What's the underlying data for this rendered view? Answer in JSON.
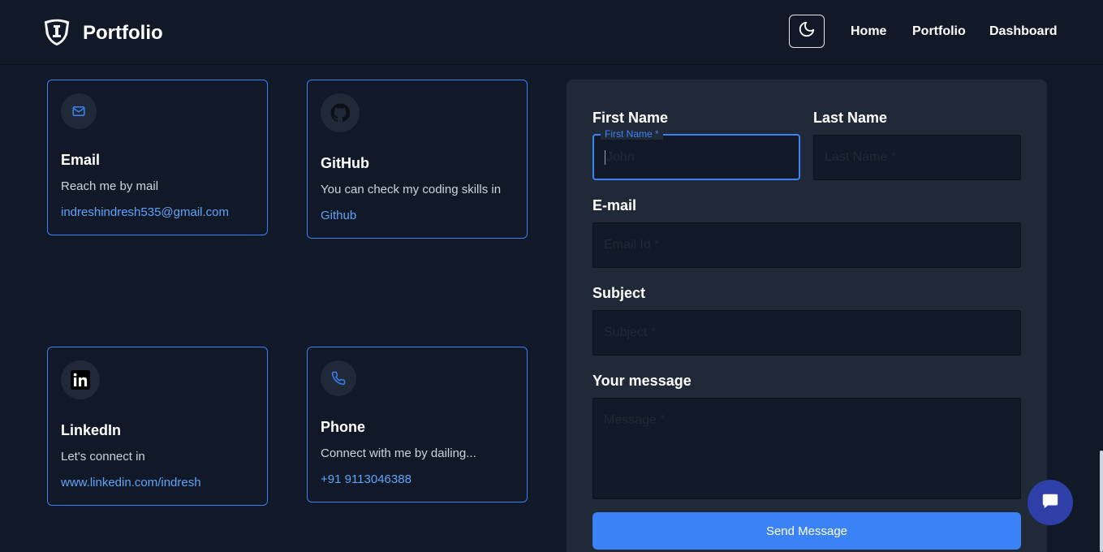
{
  "header": {
    "brand": "Portfolio",
    "nav": [
      "Home",
      "Portfolio",
      "Dashboard"
    ]
  },
  "cards": [
    {
      "title": "Email",
      "desc": "Reach me by mail",
      "link": "indreshindresh535@gmail.com",
      "icon": "mail-icon"
    },
    {
      "title": "GitHub",
      "desc": "You can check my coding skills in",
      "link": "Github",
      "icon": "github-icon"
    },
    {
      "title": "LinkedIn",
      "desc": "Let's connect in",
      "link": "www.linkedin.com/indresh",
      "icon": "linkedin-icon"
    },
    {
      "title": "Phone",
      "desc": "Connect with me by dailing...",
      "link": "+91 9113046388",
      "icon": "phone-icon"
    }
  ],
  "form": {
    "first_name_label": "First Name",
    "first_name_float": "First Name *",
    "first_name_placeholder": "John",
    "last_name_label": "Last Name",
    "last_name_placeholder": "Last Name *",
    "email_label": "E-mail",
    "email_placeholder": "Email Id *",
    "subject_label": "Subject",
    "subject_placeholder": "Subject *",
    "message_label": "Your message",
    "message_placeholder": "Message *",
    "send_label": "Send Message"
  },
  "colors": {
    "background": "#111827",
    "panel": "#1f2937",
    "accent": "#3b82f6",
    "link": "#60a5fa"
  }
}
